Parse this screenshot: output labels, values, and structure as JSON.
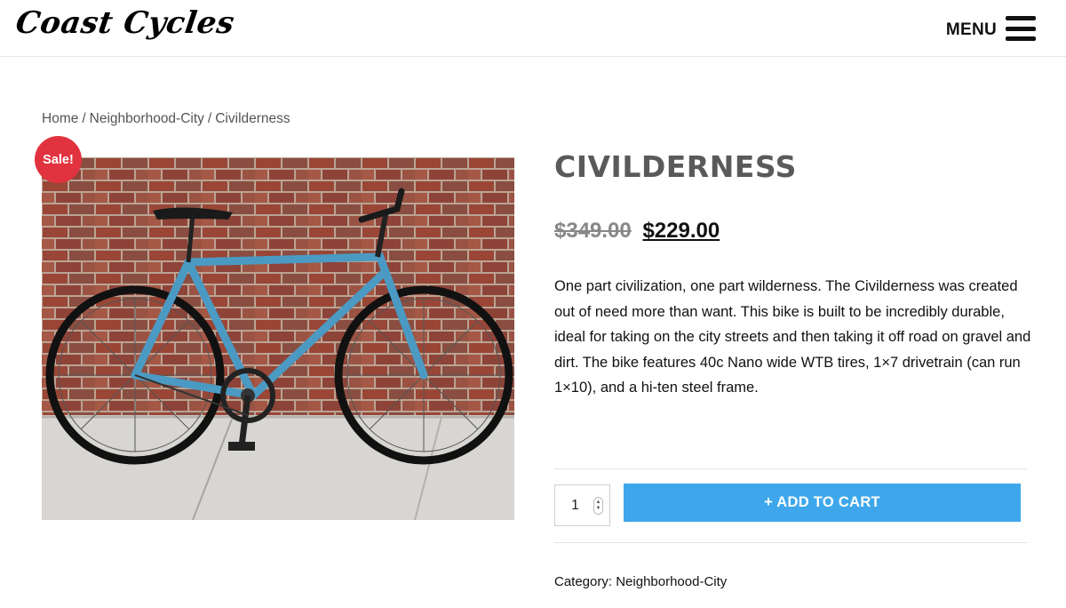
{
  "header": {
    "logo": "Coast Cycles",
    "menu_label": "MENU"
  },
  "breadcrumb": {
    "home": "Home",
    "category": "Neighborhood-City",
    "current": "Civilderness",
    "separator": "/"
  },
  "product": {
    "sale_badge": "Sale!",
    "title": "Civilderness",
    "old_price": "$349.00",
    "new_price": "$229.00",
    "description": "One part civilization, one part wilderness. The Civilderness was created out of need more than want. This bike is built to be incredibly durable, ideal for taking on the city streets and then taking it off road on gravel and dirt. The bike features 40c Nano wide WTB tires, 1×7 drivetrain (can run 1×10), and a hi-ten steel frame.",
    "quantity": "1",
    "add_to_cart_label": "+ ADD TO CART",
    "category_label": "Category:",
    "category_value": "Neighborhood-City"
  },
  "colors": {
    "accent": "#3ea7ec",
    "sale": "#e1333f",
    "title": "#5a5a5a"
  }
}
